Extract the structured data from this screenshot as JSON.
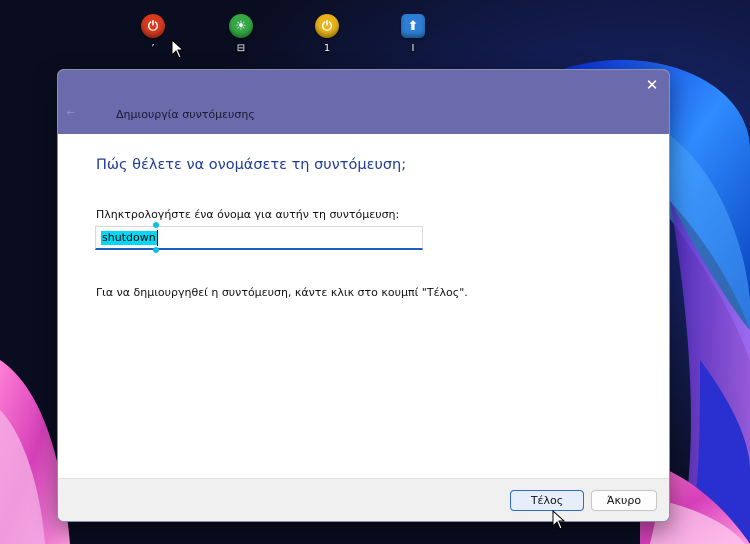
{
  "desktop": {
    "icons": [
      {
        "name": "restart-shortcut",
        "label": "’",
        "color": "#d63b1f",
        "glyph": "⏻"
      },
      {
        "name": "tool-shortcut",
        "label": "⊟",
        "color": "#35a845",
        "glyph": "☀"
      },
      {
        "name": "shutdown-shortcut-1",
        "label": "1",
        "color": "#e8b21a",
        "glyph": "⏻"
      },
      {
        "name": "update-shortcut",
        "label": "I",
        "color": "#2d7fd6",
        "glyph": "⬆"
      }
    ]
  },
  "dialog": {
    "title": "Δημιουργία συντόμευσης",
    "close_glyph": "✕",
    "back_glyph": "←",
    "heading": "Πώς θέλετε να ονομάσετε τη συντόμευση;",
    "prompt_label": "Πληκτρολογήστε ένα όνομα για αυτήν τη συντόμευση:",
    "name_value": "shutdown",
    "info_text": "Για να δημιουργηθεί η συντόμευση, κάντε κλικ στο κουμπί \"Τέλος\".",
    "finish_label": "Τέλος",
    "cancel_label": "Άκυρο"
  },
  "colors": {
    "titlebar": "#6a6aac",
    "heading": "#1f3c96",
    "selection": "#00d9f5",
    "accent": "#2b6cd1"
  }
}
